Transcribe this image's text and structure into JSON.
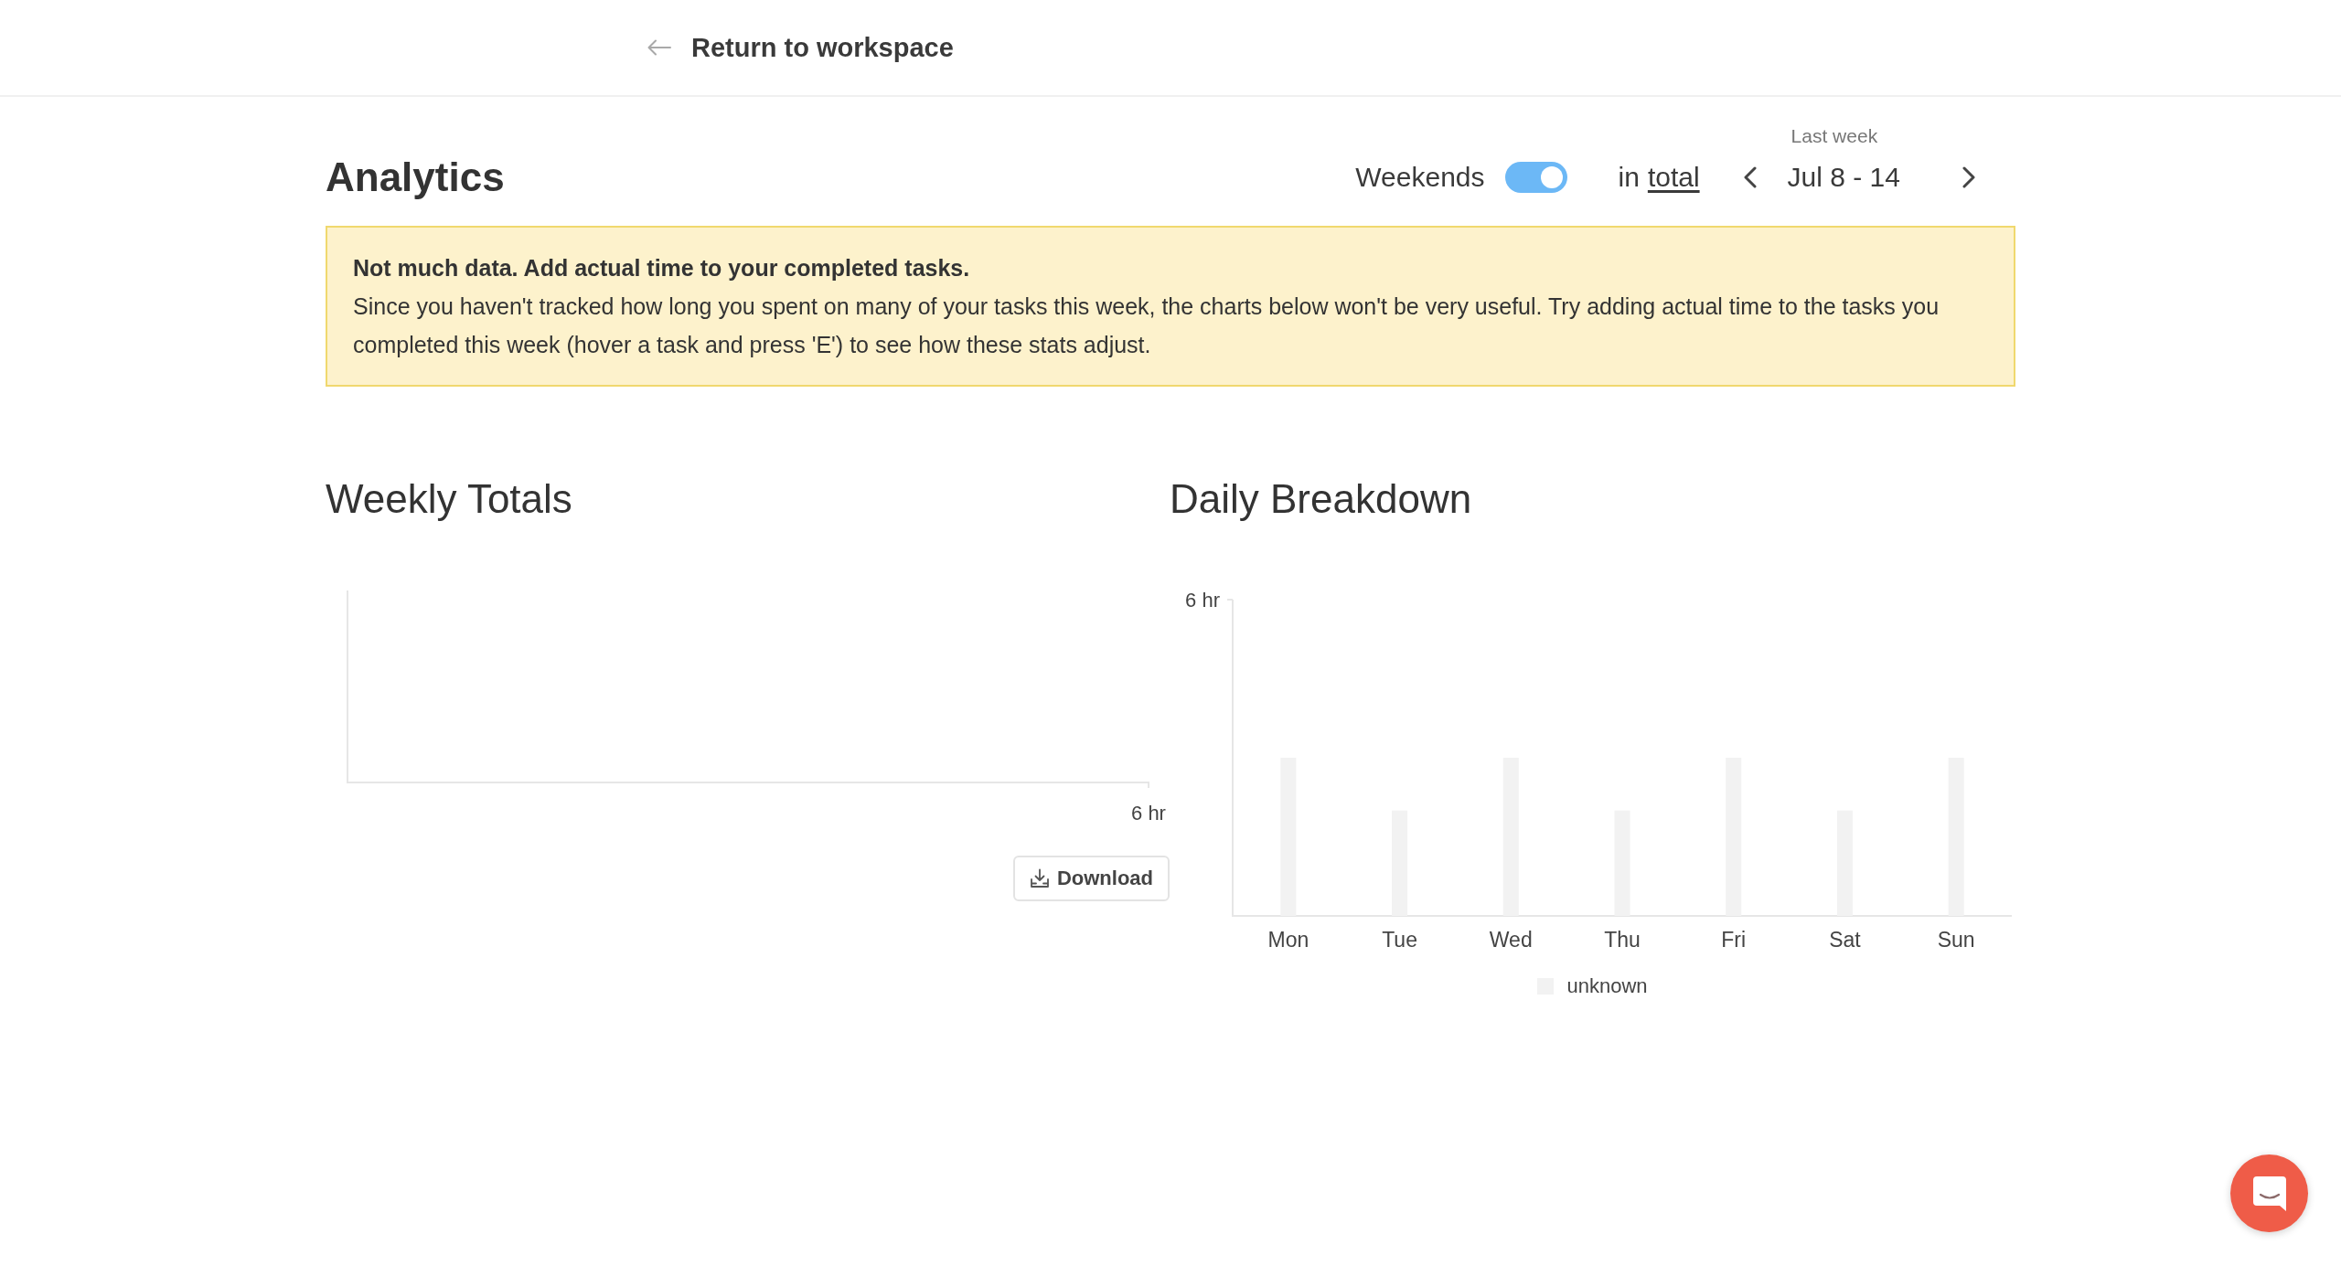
{
  "top_bar": {
    "back_link": "Return to workspace"
  },
  "header": {
    "title": "Analytics",
    "weekends_toggle": {
      "label": "Weekends",
      "on": true
    },
    "aggregation": {
      "prefix": "in",
      "link": "total"
    },
    "period": {
      "caption": "Last week",
      "range": "Jul 8 - 14"
    }
  },
  "notice": {
    "title": "Not much data. Add actual time to your completed tasks.",
    "body": "Since you haven't tracked how long you spent on many of your tasks this week, the charts below won't be very useful. Try adding actual time to the tasks you completed this week (hover a task and press 'E') to see how these stats adjust."
  },
  "weekly_totals": {
    "title": "Weekly Totals",
    "axis_end_label": "6 hr",
    "download_button": "Download"
  },
  "daily_breakdown": {
    "title": "Daily Breakdown",
    "chart_data": {
      "type": "bar",
      "categories": [
        "Mon",
        "Tue",
        "Wed",
        "Thu",
        "Fri",
        "Sat",
        "Sun"
      ],
      "series": [
        {
          "name": "unknown",
          "color": "#f2f2f2",
          "values": [
            3,
            2,
            3,
            2,
            3,
            2,
            3
          ]
        }
      ],
      "ylim": [
        0,
        6
      ],
      "yticks": [
        {
          "value": 6,
          "label": "6 hr"
        }
      ]
    }
  }
}
